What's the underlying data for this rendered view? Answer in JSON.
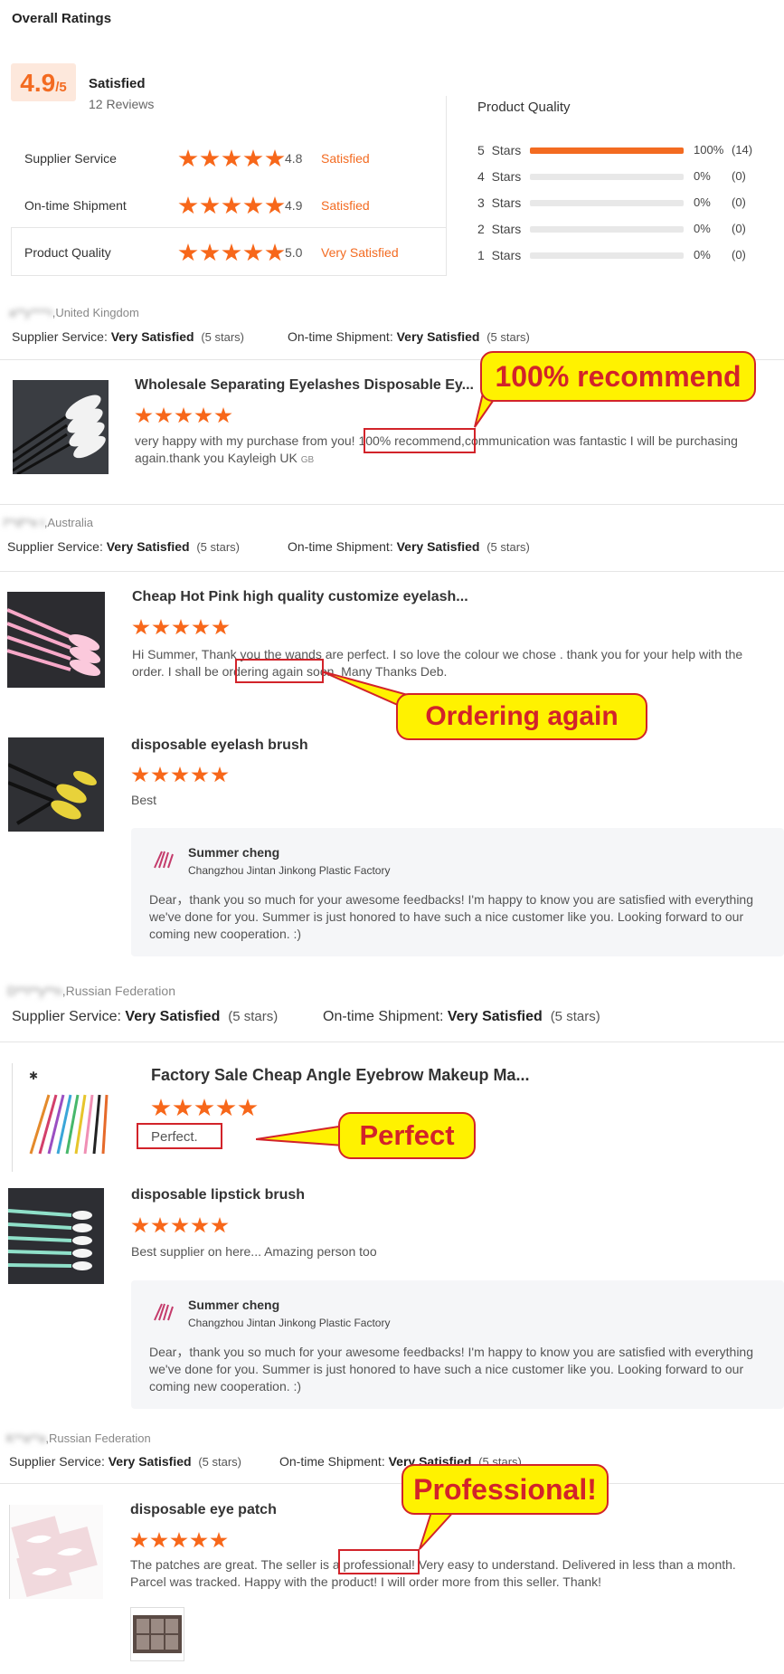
{
  "header": {
    "title": "Overall Ratings"
  },
  "overall": {
    "score": "4.9",
    "outof": "/5",
    "label": "Satisfied",
    "reviews": "12 Reviews"
  },
  "rating_rows": [
    {
      "label": "Supplier Service",
      "value": "4.8",
      "status": "Satisfied"
    },
    {
      "label": "On-time Shipment",
      "value": "4.9",
      "status": "Satisfied"
    },
    {
      "label": "Product Quality",
      "value": "5.0",
      "status": "Very Satisfied"
    }
  ],
  "quality": {
    "title": "Product Quality",
    "rows": [
      {
        "star": "5",
        "label": "Stars",
        "fill": 1.0,
        "pct": "100%",
        "count": "(14)"
      },
      {
        "star": "4",
        "label": "Stars",
        "fill": 0,
        "pct": "0%",
        "count": "(0)"
      },
      {
        "star": "3",
        "label": "Stars",
        "fill": 0,
        "pct": "0%",
        "count": "(0)"
      },
      {
        "star": "2",
        "label": "Stars",
        "fill": 0,
        "pct": "0%",
        "count": "(0)"
      },
      {
        "star": "1",
        "label": "Stars",
        "fill": 0,
        "pct": "0%",
        "count": "(0)"
      }
    ]
  },
  "reviews": [
    {
      "user": "a**y****r",
      "country": ",United Kingdom",
      "ss_label": "Supplier Service:",
      "ss_value": "Very Satisfied",
      "ss_stars": "(5 stars)",
      "os_label": "On-time Shipment:",
      "os_value": "Very Satisfied",
      "os_stars": "(5 stars)",
      "products": [
        {
          "name": "Wholesale Separating Eyelashes Disposable Ey...",
          "text_a": "very happy with my purchase from you! ",
          "text_hl": "100% recommend,",
          "text_b": "communication was fantastic I will be purchasing again.thank you Kayleigh UK",
          "text_tag": "GB"
        }
      ]
    },
    {
      "user": "l**d**e t",
      "country": ",Australia",
      "ss_label": "Supplier Service:",
      "ss_value": "Very Satisfied",
      "ss_stars": "(5 stars)",
      "os_label": "On-time Shipment:",
      "os_value": "Very Satisfied",
      "os_stars": "(5 stars)",
      "products": [
        {
          "name": "Cheap Hot Pink high quality customize eyelash...",
          "text_a": "Hi Summer, Thank you the wands are perfect. I so love the colour we chose . thank you for your help with the order. I shall be ",
          "text_hl": "ordering again",
          "text_b": " soon. Many Thanks Deb."
        },
        {
          "name": "disposable eyelash brush",
          "text": "Best",
          "reply": {
            "name": "Summer cheng",
            "company": "Changzhou Jintan Jinkong Plastic Factory",
            "text": "Dear，thank you so much for your awesome feedbacks! I'm happy to know you are satisfied with everything we've done for you. Summer is just honored to have such a nice customer like you. Looking forward to our coming new cooperation. :)"
          }
        }
      ]
    },
    {
      "user": "D**i**y**n",
      "country": ",Russian Federation",
      "ss_label": "Supplier Service:",
      "ss_value": "Very Satisfied",
      "ss_stars": "(5 stars)",
      "os_label": "On-time Shipment:",
      "os_value": "Very Satisfied",
      "os_stars": "(5 stars)",
      "products": [
        {
          "name": "Factory Sale Cheap Angle Eyebrow Makeup Ma...",
          "text": "Perfect."
        },
        {
          "name": "disposable lipstick brush",
          "text": "Best supplier on here... Amazing person too",
          "reply": {
            "name": "Summer cheng",
            "company": "Changzhou Jintan Jinkong Plastic Factory",
            "text": "Dear，thank you so much for your awesome feedbacks! I'm happy to know you are satisfied with everything we've done for you. Summer is just honored to have such a nice customer like you. Looking forward to our coming new cooperation. :)"
          }
        }
      ]
    },
    {
      "user": "K**a**a",
      "country": ",Russian Federation",
      "ss_label": "Supplier Service:",
      "ss_value": "Very Satisfied",
      "ss_stars": "(5 stars)",
      "os_label": "On-time Shipment:",
      "os_value": "Very Satisfied",
      "os_stars": "(5 stars)",
      "products": [
        {
          "name": "disposable eye patch",
          "text_a": "The patches are great. The seller is a ",
          "text_hl": "professional!",
          "text_b": " Very easy to understand. Delivered in less than a month. Parcel was tracked. Happy with the product! I will order more from this seller. Thank!"
        }
      ]
    }
  ],
  "callouts": [
    "100% recommend",
    "Ordering again",
    "Perfect",
    "Professional!"
  ],
  "colors": {
    "accent": "#f36b21",
    "callout_bg": "#fff200",
    "callout_border": "#d2232a"
  }
}
